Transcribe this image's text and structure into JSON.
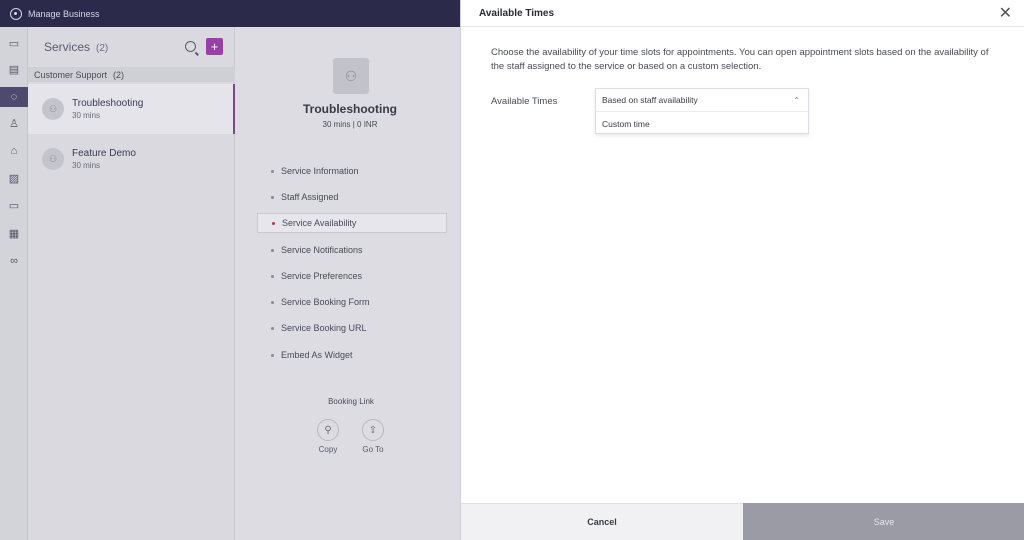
{
  "topbar": {
    "title": "Manage Business"
  },
  "rail": {
    "icons": [
      "inbox-icon",
      "calendar-list-icon",
      "services-icon",
      "staff-icon",
      "workspace-icon",
      "gallery-icon",
      "payments-icon",
      "schedule-icon",
      "integrations-icon"
    ]
  },
  "services": {
    "title": "Services",
    "count": "(2)",
    "add_label": "+",
    "group": {
      "name": "Customer Support",
      "count": "(2)"
    },
    "items": [
      {
        "name": "Troubleshooting",
        "duration": "30 mins"
      },
      {
        "name": "Feature Demo",
        "duration": "30 mins"
      }
    ]
  },
  "detail": {
    "name": "Troubleshooting",
    "meta": "30 mins | 0 INR",
    "menu": [
      "Service Information",
      "Staff Assigned",
      "Service Availability",
      "Service Notifications",
      "Service Preferences",
      "Service Booking Form",
      "Service Booking URL",
      "Embed As Widget"
    ],
    "booking_link": {
      "title": "Booking Link",
      "copy": "Copy",
      "goto": "Go To"
    }
  },
  "panel": {
    "title": "Available Times",
    "description": "Choose the availability of your time slots for appointments. You can open appointment slots based on the availability of the staff assigned to the service or based on a custom selection.",
    "field_label": "Available Times",
    "dropdown": {
      "selected": "Based on staff availability",
      "options": [
        "Based on staff availability",
        "Custom time"
      ]
    },
    "cancel": "Cancel",
    "save": "Save"
  }
}
